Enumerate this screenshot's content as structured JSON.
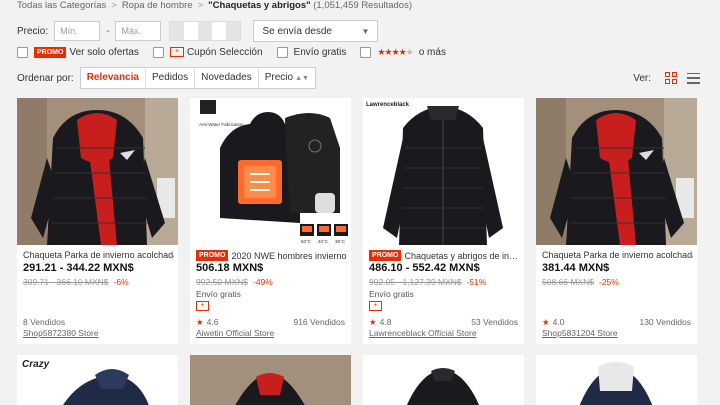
{
  "breadcrumb": {
    "all": "Todas las Categorías",
    "cat": "Ropa de hombre",
    "query": "\"Chaquetas y abrigos\"",
    "results": "(1,051,459 Resultados)",
    "sep": ">"
  },
  "filters": {
    "price_label": "Precio:",
    "min_placeholder": "Mín.",
    "max_placeholder": "Máx.",
    "dash": "-",
    "ship_from": "Se envía desde",
    "options": {
      "promo_tag": "PROMO",
      "promo": "Ver solo ofertas",
      "coupon_tag": "+",
      "coupon": "Cupón Selección",
      "free_shipping": "Envío gratis",
      "rating_stars": "★★★★",
      "rating_dim_star": "★",
      "rating": "o más"
    }
  },
  "sort": {
    "label": "Ordenar por:",
    "options": [
      "Relevancia",
      "Pedidos",
      "Novedades",
      "Precio"
    ],
    "active": "Relevancia",
    "price_arrows": "▲▼",
    "view_label": "Ver:"
  },
  "icons": {
    "chevron": "chevron-down-icon",
    "grid": "grid-view-icon",
    "list": "list-view-icon",
    "star": "star-icon"
  },
  "colors": {
    "accent": "#e62e04",
    "jacket": "#1a1a1e",
    "lining": "#c81e1e",
    "heater": "#ff6a2a"
  },
  "products": [
    {
      "title": "Chaqueta Parka de invierno acolchada",
      "price": "291.21 - 344.22 MXN$",
      "old_price": "309.71 - 366.10 MXN$",
      "discount": "-6%",
      "sold": "8 Vendidos",
      "store": "Shop5872380 Store"
    },
    {
      "promo": "PROMO",
      "title": "2020 NWE hombres invierno",
      "price": "506.18 MXN$",
      "old_price": "992.50 MXN$",
      "discount": "-49%",
      "shipping": "Envío gratis",
      "coupon": "+",
      "star": "★",
      "rating": "4.6",
      "sold": "916 Vendidos",
      "store": "Aiwetin Official Store",
      "badge": "Anti-Water Fabrication",
      "temps": [
        "50°C",
        "40°C",
        "38°C"
      ]
    },
    {
      "brand": "Lawrenceblack",
      "promo": "PROMO",
      "title": "Chaquetas y abrigos de invierno",
      "price": "486.10 - 552.42 MXN$",
      "old_price": "992.05 - 1,127.39 MXN$",
      "discount": "-51%",
      "shipping": "Envío gratis",
      "coupon": "+",
      "star": "★",
      "rating": "4.8",
      "sold": "53 Vendidos",
      "store": "Lawrenceblack Official Store"
    },
    {
      "title": "Chaqueta Parka de invierno acolchada",
      "price": "381.44 MXN$",
      "old_price": "508.66 MXN$",
      "discount": "-25%",
      "star": "★",
      "rating": "4.0",
      "sold": "130 Vendidos",
      "store": "Shop5831204 Store"
    }
  ],
  "row2": {
    "brand": "Crazy"
  }
}
